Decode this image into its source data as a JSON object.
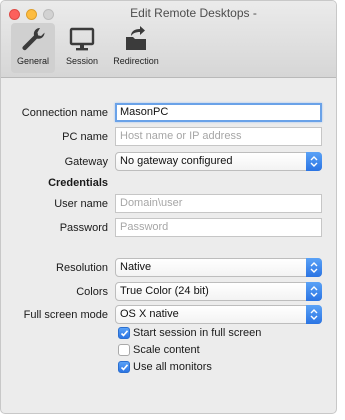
{
  "window": {
    "title": "Edit Remote Desktops -"
  },
  "toolbar": {
    "tabs": [
      {
        "label": "General",
        "icon": "wrench-icon",
        "active": true
      },
      {
        "label": "Session",
        "icon": "monitor-icon",
        "active": false
      },
      {
        "label": "Redirection",
        "icon": "folder-redirect-icon",
        "active": false
      }
    ]
  },
  "form": {
    "connection_name": {
      "label": "Connection name",
      "value": "MasonPC"
    },
    "pc_name": {
      "label": "PC name",
      "value": "",
      "placeholder": "Host name or IP address"
    },
    "gateway": {
      "label": "Gateway",
      "value": "No gateway configured"
    },
    "credentials": {
      "heading": "Credentials"
    },
    "user_name": {
      "label": "User name",
      "value": "",
      "placeholder": "Domain\\user"
    },
    "password": {
      "label": "Password",
      "value": "",
      "placeholder": "Password"
    },
    "resolution": {
      "label": "Resolution",
      "value": "Native"
    },
    "colors": {
      "label": "Colors",
      "value": "True Color (24 bit)"
    },
    "full_screen_mode": {
      "label": "Full screen mode",
      "value": "OS X native"
    },
    "options": [
      {
        "label": "Start session in full screen",
        "checked": true
      },
      {
        "label": "Scale content",
        "checked": false
      },
      {
        "label": "Use all monitors",
        "checked": true
      }
    ]
  },
  "colors": {
    "accent": "#2b74e3",
    "focus_ring": "#6aa2e8"
  }
}
